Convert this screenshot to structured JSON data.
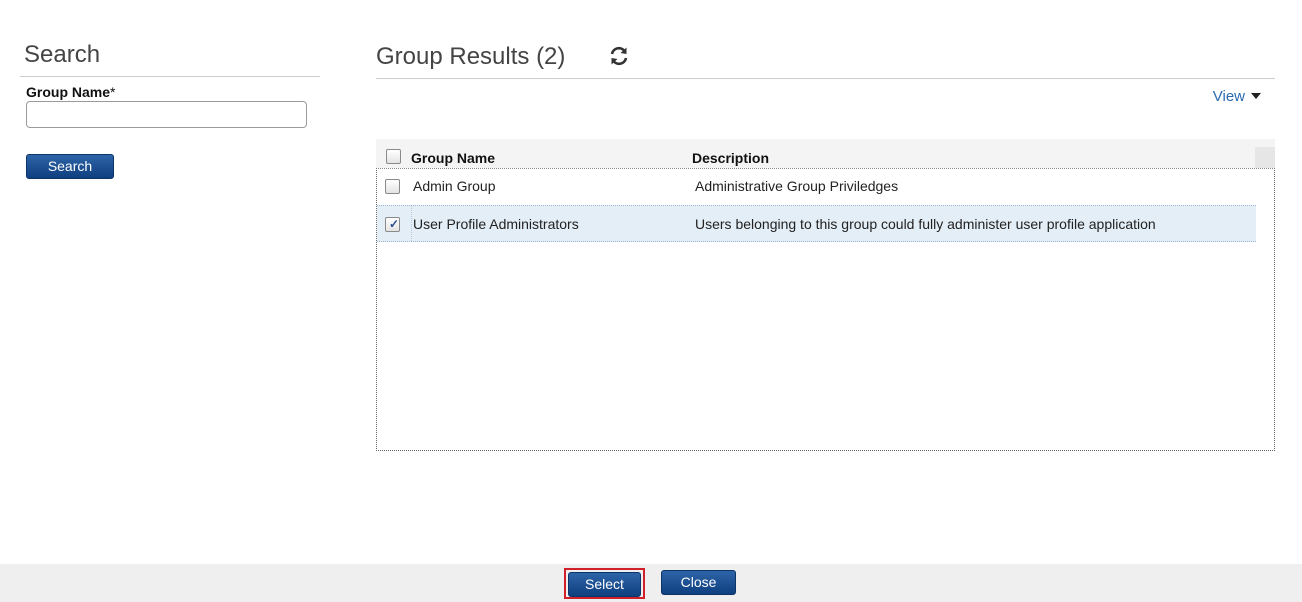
{
  "search": {
    "title": "Search",
    "group_name_label": "Group Name",
    "required_marker": "*",
    "group_name_value": "",
    "search_button": "Search"
  },
  "results": {
    "title": "Group Results (2)",
    "refresh_icon": "refresh-icon",
    "view_label": "View",
    "columns": {
      "group_name": "Group Name",
      "description": "Description"
    },
    "rows": [
      {
        "group_name": "Admin Group",
        "description": "Administrative Group Priviledges",
        "checked": false
      },
      {
        "group_name": "User Profile Administrators",
        "description": "Users belonging to this group could fully administer user profile application",
        "checked": true
      }
    ]
  },
  "footer": {
    "select_button": "Select",
    "close_button": "Close"
  },
  "colors": {
    "button_blue": "#1a4c8e",
    "selected_row": "#e3eef7",
    "focus_outline": "#d0202a",
    "link": "#2a6ab0"
  }
}
